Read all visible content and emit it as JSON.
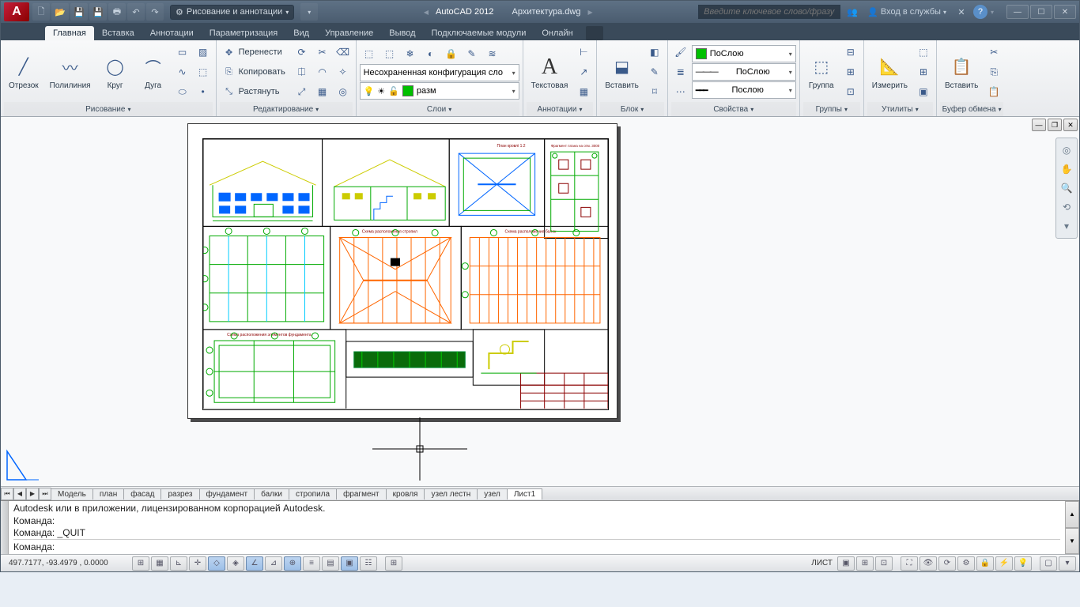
{
  "title": {
    "app": "AutoCAD 2012",
    "file": "Архитектура.dwg"
  },
  "workspace": "Рисование и аннотации",
  "search_placeholder": "Введите ключевое слово/фразу",
  "login_label": "Вход в службы",
  "tabs": [
    "Главная",
    "Вставка",
    "Аннотации",
    "Параметризация",
    "Вид",
    "Управление",
    "Вывод",
    "Подключаемые модули",
    "Онлайн"
  ],
  "active_tab": 0,
  "ribbon": {
    "draw": {
      "title": "Рисование",
      "line": "Отрезок",
      "polyline": "Полилиния",
      "circle": "Круг",
      "arc": "Дуга"
    },
    "edit": {
      "title": "Редактирование",
      "move": "Перенести",
      "copy": "Копировать",
      "stretch": "Растянуть"
    },
    "layers": {
      "title": "Слои",
      "unsaved": "Несохраненная конфигурация сло",
      "current": "разм"
    },
    "annot": {
      "title": "Аннотации",
      "text": "Текстовая"
    },
    "block": {
      "title": "Блок",
      "insert": "Вставить"
    },
    "props": {
      "title": "Свойства",
      "color": "ПоСлою",
      "ltype": "ПоСлою",
      "lweight": "Послою"
    },
    "groups": {
      "title": "Группы",
      "group": "Группа"
    },
    "util": {
      "title": "Утилиты",
      "measure": "Измерить"
    },
    "clip": {
      "title": "Буфер обмена",
      "paste": "Вставить"
    }
  },
  "layout_tabs": [
    "Модель",
    "план",
    "фасад",
    "разрез",
    "фундамент",
    "балки",
    "стропила",
    "фрагмент",
    "кровля",
    "узел лестн",
    "узел",
    "Лист1"
  ],
  "active_layout": 11,
  "command": {
    "history": [
      "Autodesk или в приложении, лицензированном корпорацией Autodesk.",
      "Команда:",
      "Команда: _QUIT"
    ],
    "prompt": "Команда:"
  },
  "status": {
    "coords": "497.7177, -93.4979 , 0.0000",
    "space": "ЛИСТ"
  },
  "drawing_labels": {
    "roof_plan": "План кровлі 1:2",
    "fragment": "Фрагмент плана на отм. 3000",
    "rafters": "Схема расположения стропил",
    "beams2": "Схема расположения балок",
    "foundation": "Схема расположения элементов фундамента"
  }
}
